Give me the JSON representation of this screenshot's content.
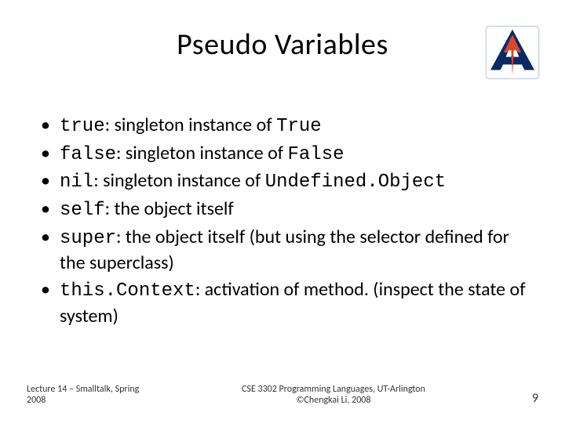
{
  "logo": {
    "name": "uta-a-logo"
  },
  "title": "Pseudo Variables",
  "bullets": [
    {
      "code1": "true",
      "t1": ": singleton instance of ",
      "code2": "True",
      "t2": ""
    },
    {
      "code1": "false",
      "t1": ": singleton instance of ",
      "code2": "False",
      "t2": ""
    },
    {
      "code1": "nil",
      "t1": ": singleton instance of ",
      "code2": "Undefined.Object",
      "t2": ""
    },
    {
      "code1": "self",
      "t1": ": the object itself",
      "code2": "",
      "t2": ""
    },
    {
      "code1": "super",
      "t1": ": the object itself (but using the selector defined for the superclass)",
      "code2": "",
      "t2": ""
    },
    {
      "code1": "this.Context",
      "t1": ": activation of method. (inspect the state of system)",
      "code2": "",
      "t2": ""
    }
  ],
  "footer": {
    "left": "Lecture 14 – Smalltalk, Spring 2008",
    "center_line1": "CSE 3302 Programming Languages, UT-Arlington",
    "center_line2": "©Chengkai Li, 2008",
    "page": "9"
  }
}
